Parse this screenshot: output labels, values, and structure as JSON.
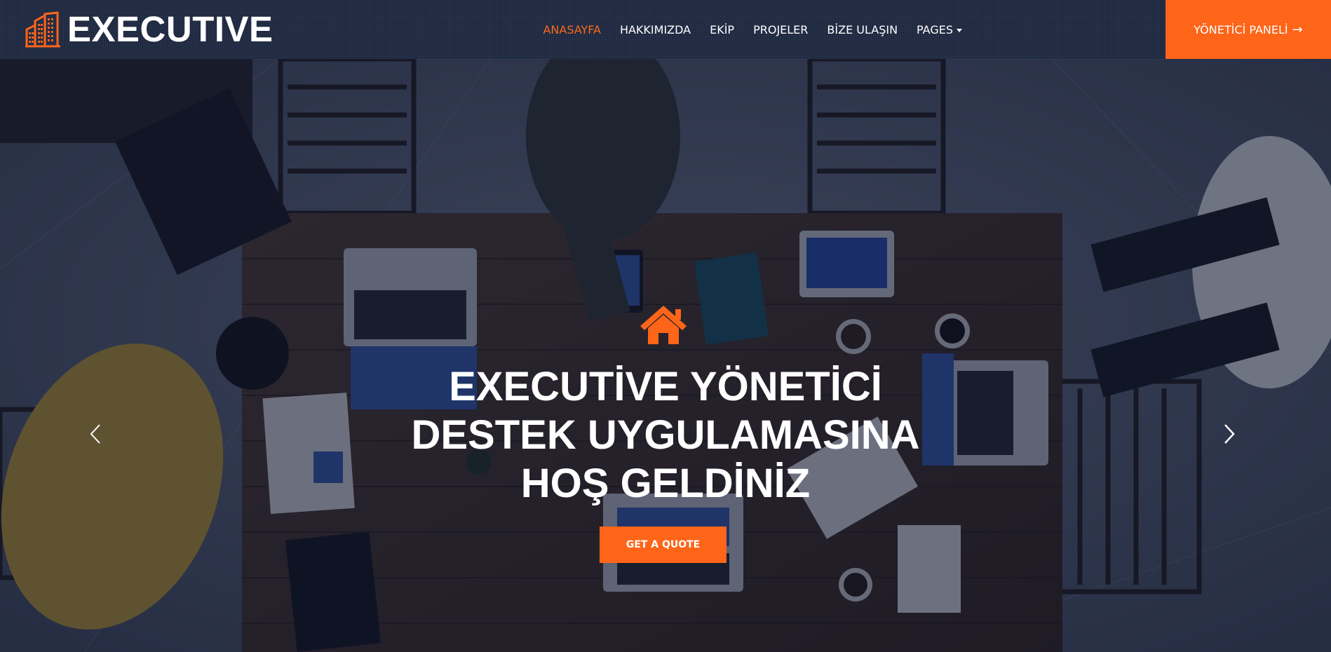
{
  "brand": {
    "name": "EXECUTIVE",
    "icon": "building-icon"
  },
  "nav": {
    "items": [
      {
        "label": "ANASAYFA",
        "active": true
      },
      {
        "label": "HAKKIMIZDA",
        "active": false
      },
      {
        "label": "EKİP",
        "active": false
      },
      {
        "label": "PROJELER",
        "active": false
      },
      {
        "label": "BİZE ULAŞIN",
        "active": false
      },
      {
        "label": "PAGES",
        "active": false,
        "dropdown": true
      }
    ],
    "admin_button": {
      "label": "YÖNETİCİ PANELİ",
      "arrow": "→"
    }
  },
  "hero": {
    "icon": "home-icon",
    "title_lines": [
      "EXECUTİVE YÖNETİCİ",
      "DESTEK UYGULAMASINA",
      "HOŞ GELDİNİZ"
    ],
    "cta_label": "GET A QUOTE",
    "prev_icon": "chevron-left-icon",
    "next_icon": "chevron-right-icon"
  },
  "colors": {
    "accent": "#fe6519",
    "nav_bg": "#1d2840",
    "overlay": "#080e28",
    "text": "#ffffff"
  }
}
